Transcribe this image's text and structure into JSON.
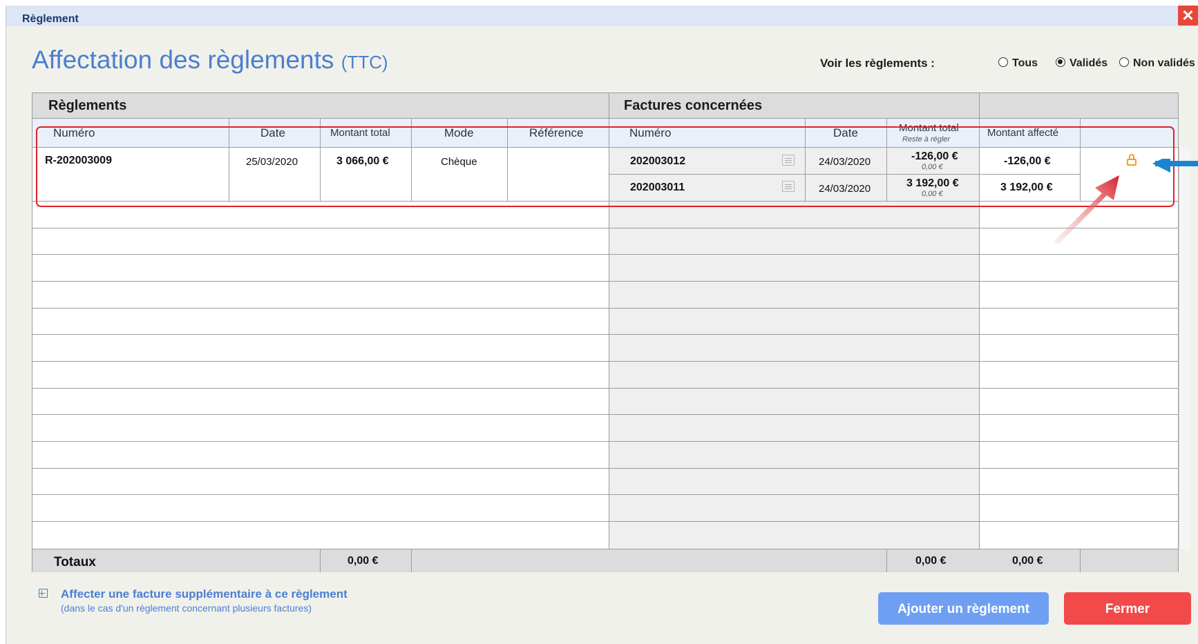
{
  "window": {
    "title": "Règlement",
    "close_glyph": "✕"
  },
  "page": {
    "title": "Affectation des règlements",
    "title_suffix": "(TTC)"
  },
  "filter": {
    "label": "Voir les règlements :",
    "options": [
      {
        "label": "Tous",
        "selected": false
      },
      {
        "label": "Validés",
        "selected": true
      },
      {
        "label": "Non validés",
        "selected": false
      }
    ]
  },
  "sections": {
    "reglements": "Règlements",
    "factures": "Factures concernées"
  },
  "columns": {
    "reg_numero": "Numéro",
    "reg_date": "Date",
    "reg_montant": "Montant total",
    "reg_mode": "Mode",
    "reg_reference": "Référence",
    "fac_numero": "Numéro",
    "fac_date": "Date",
    "fac_montant": "Montant total",
    "fac_reste": "Reste à régler",
    "montant_affecte": "Montant affecté"
  },
  "reglement": {
    "numero": "R-202003009",
    "date": "25/03/2020",
    "montant": "3 066,00 €",
    "mode": "Chèque",
    "reference": ""
  },
  "factures": [
    {
      "numero": "202003012",
      "date": "24/03/2020",
      "montant": "-126,00 €",
      "reste": "0,00 €",
      "affecte": "-126,00 €"
    },
    {
      "numero": "202003011",
      "date": "24/03/2020",
      "montant": "3 192,00 €",
      "reste": "0,00 €",
      "affecte": "3 192,00 €"
    }
  ],
  "totaux": {
    "label": "Totaux",
    "reglements": "0,00 €",
    "factures": "0,00 €",
    "affecte": "0,00 €"
  },
  "footer": {
    "add_link": "Affecter une facture supplémentaire à ce règlement",
    "add_hint": "(dans le cas d'un règlement concernant plusieurs factures)",
    "add_button": "Ajouter un règlement",
    "close_button": "Fermer"
  },
  "colors": {
    "accent": "#4a7fd1",
    "highlight": "#e0202a",
    "add_button": "#6f9ff2",
    "close_button": "#f2494b",
    "lock": "#f0a020"
  }
}
